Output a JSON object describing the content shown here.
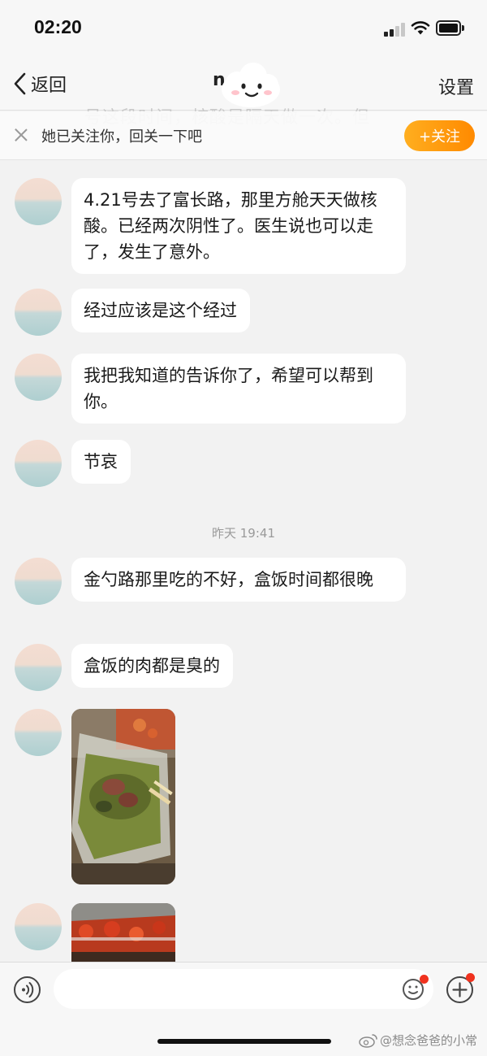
{
  "status_bar": {
    "time": "02:20"
  },
  "nav": {
    "back_label": "返回",
    "title_fragment": "n",
    "settings_label": "设置"
  },
  "ghost_previous_message": "号这段时间，核酸是隔天做一次。但",
  "follow_banner": {
    "text": "她已关注你，回关一下吧",
    "follow_label": "+关注"
  },
  "messages": [
    {
      "type": "text",
      "text": "4.21号去了富长路，那里方舱天天做核酸。已经两次阴性了。医生说也可以走了，发生了意外。"
    },
    {
      "type": "text",
      "text": "经过应该是这个经过"
    },
    {
      "type": "text",
      "text": "我把我知道的告诉你了，希望可以帮到你。"
    },
    {
      "type": "text",
      "text": "节哀"
    },
    {
      "type": "timestamp",
      "text": "昨天 19:41"
    },
    {
      "type": "text",
      "text": "金勺路那里吃的不好，盒饭时间都很晚"
    },
    {
      "type": "text",
      "text": "盒饭的肉都是臭的"
    },
    {
      "type": "image",
      "subject": "boxed-meal-photo"
    },
    {
      "type": "image",
      "subject": "boxed-meal-photo"
    }
  ],
  "input_bar": {
    "placeholder": ""
  },
  "watermark": "@想念爸爸的小常",
  "colors": {
    "accent_orange": "#ff9a0e",
    "chat_background": "#f2f2f2",
    "bubble": "#ffffff",
    "notification_dot": "#f0321e"
  },
  "icons": [
    "back-chevron-icon",
    "signal-icon",
    "wifi-icon",
    "battery-icon",
    "close-icon",
    "voice-icon",
    "emoji-icon",
    "plus-icon",
    "weibo-icon"
  ]
}
